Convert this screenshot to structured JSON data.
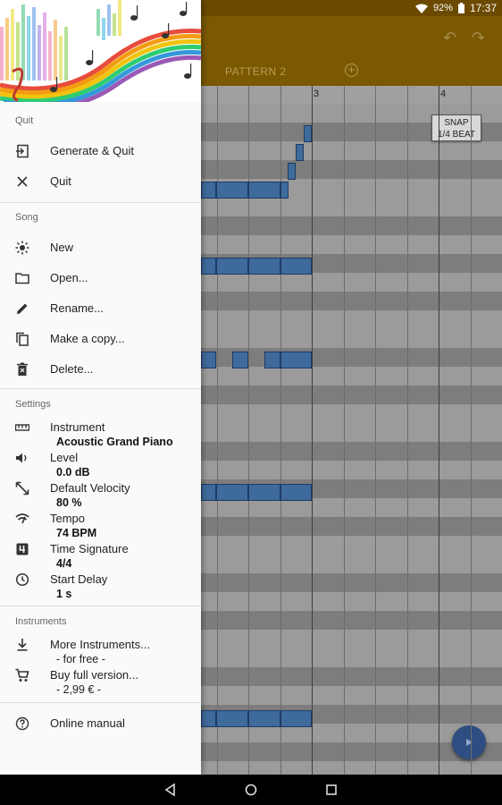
{
  "status_bar": {
    "battery": "92%",
    "time": "17:37"
  },
  "toolbar": {
    "pattern_tab": "PATTERN 2"
  },
  "ruler": {
    "bar_3": "3",
    "bar_4": "4"
  },
  "snap": {
    "line1": "SNAP",
    "line2": "1/4 BEAT"
  },
  "drawer": {
    "sections": {
      "quit": "Quit",
      "song": "Song",
      "settings": "Settings",
      "instruments": "Instruments"
    },
    "quit_items": {
      "generate_quit": "Generate & Quit",
      "quit": "Quit"
    },
    "song_items": {
      "new": "New",
      "open": "Open...",
      "rename": "Rename...",
      "copy": "Make a copy...",
      "delete": "Delete..."
    },
    "settings_items": {
      "instrument": {
        "label": "Instrument",
        "value": "Acoustic Grand Piano"
      },
      "level": {
        "label": "Level",
        "value": "0.0 dB"
      },
      "velocity": {
        "label": "Default Velocity",
        "value": "80 %"
      },
      "tempo": {
        "label": "Tempo",
        "value": "74 BPM"
      },
      "time_signature": {
        "label": "Time Signature",
        "value": "4/4"
      },
      "start_delay": {
        "label": "Start Delay",
        "value": "1 s"
      }
    },
    "instrument_items": {
      "more": {
        "label": "More Instruments...",
        "sub": "- for free -"
      },
      "buy": {
        "label": "Buy full version...",
        "sub": "- 2,99 € -"
      }
    },
    "manual": "Online manual"
  },
  "colors": {
    "toolbar": "#7a5900",
    "note": "#3f6a9c",
    "fab": "#2e4d80",
    "drawer_bg": "#fafafa"
  }
}
